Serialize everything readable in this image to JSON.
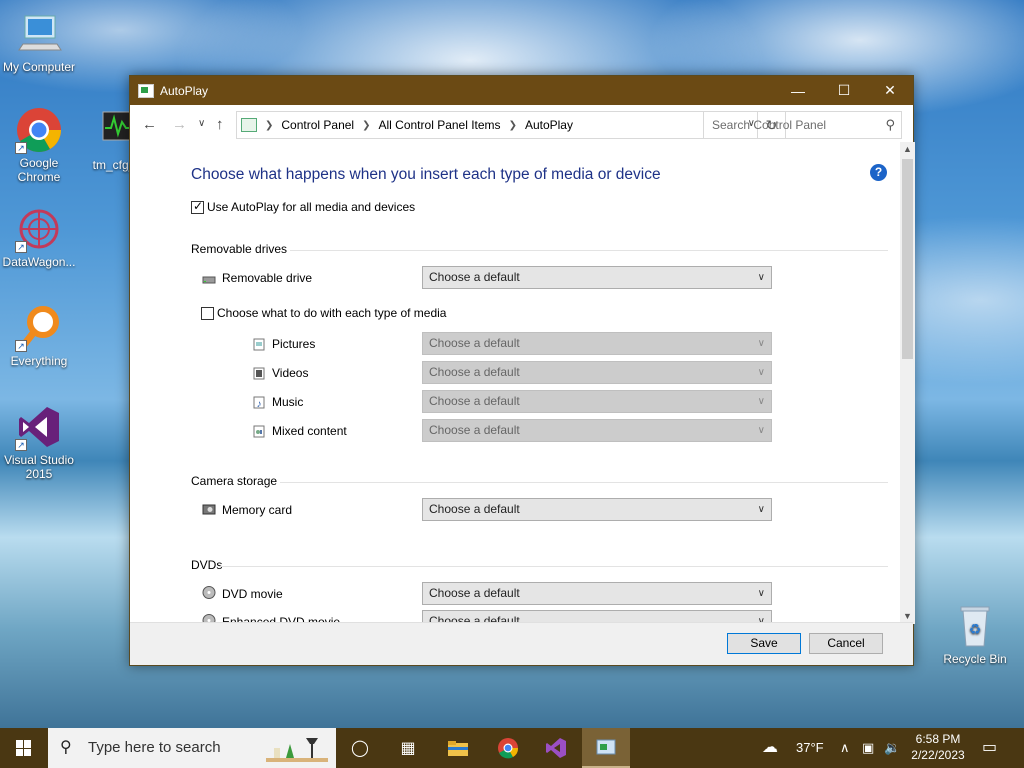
{
  "desktop": {
    "icons": [
      {
        "label": "My Computer"
      },
      {
        "label": "Google Chrome"
      },
      {
        "label": "DataWagon..."
      },
      {
        "label": "Everything"
      },
      {
        "label": "Visual Studio 2015"
      },
      {
        "label": "Recycle Bin"
      },
      {
        "label": "tm_cfg_..."
      }
    ]
  },
  "window": {
    "title": "AutoPlay",
    "breadcrumbs": [
      "Control Panel",
      "All Control Panel Items",
      "AutoPlay"
    ],
    "search_placeholder": "Search Control Panel",
    "heading": "Choose what happens when you insert each type of media or device",
    "use_autoplay_label": "Use AutoPlay for all media and devices",
    "use_autoplay_checked": true,
    "sections": {
      "removable": {
        "title": "Removable drives",
        "drive_label": "Removable drive",
        "drive_value": "Choose a default",
        "each_media_label": "Choose what to do with each type of media",
        "each_media_checked": false,
        "media": [
          {
            "label": "Pictures",
            "value": "Choose a default"
          },
          {
            "label": "Videos",
            "value": "Choose a default"
          },
          {
            "label": "Music",
            "value": "Choose a default"
          },
          {
            "label": "Mixed content",
            "value": "Choose a default"
          }
        ]
      },
      "camera": {
        "title": "Camera storage",
        "memory_label": "Memory card",
        "memory_value": "Choose a default"
      },
      "dvds": {
        "title": "DVDs",
        "dvd_movie_label": "DVD movie",
        "dvd_movie_value": "Choose a default",
        "enhanced_label": "Enhanced DVD movie",
        "enhanced_value": "Choose a default"
      }
    },
    "save_label": "Save",
    "cancel_label": "Cancel"
  },
  "taskbar": {
    "search_placeholder": "Type here to search",
    "weather": "37°F",
    "time": "6:58 PM",
    "date": "2/22/2023"
  }
}
